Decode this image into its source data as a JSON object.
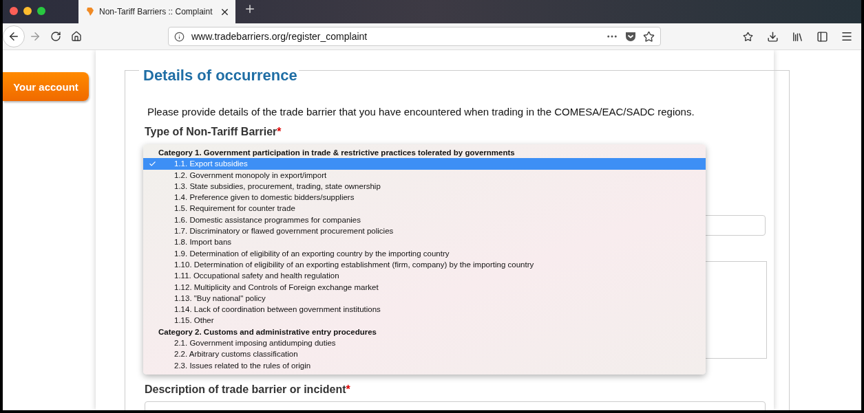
{
  "browser": {
    "tabs": [
      {
        "title": "Non-Tariff Barriers :: Complaint",
        "selected": true
      }
    ],
    "url": "www.tradebarriers.org/register_complaint"
  },
  "sidebar": {
    "button": "Your account"
  },
  "form": {
    "legend": "Details of occurrence",
    "intro": "Please provide details of the trade barrier that you have encountered when trading in the COMESA/EAC/SADC regions.",
    "type_field": {
      "label": "Type of Non-Tariff Barrier",
      "required_mark": "*"
    },
    "dropdown": {
      "groups": [
        {
          "label": "Category 1. Government participation in trade & restrictive practices tolerated by governments",
          "options": [
            {
              "label": "1.1. Export subsidies",
              "selected": true
            },
            {
              "label": "1.2. Government monopoly in export/import",
              "selected": false
            },
            {
              "label": "1.3. State subsidies, procurement, trading, state ownership",
              "selected": false
            },
            {
              "label": "1.4. Preference given to domestic bidders/suppliers",
              "selected": false
            },
            {
              "label": "1.5. Requirement for counter trade",
              "selected": false
            },
            {
              "label": "1.6. Domestic assistance programmes for companies",
              "selected": false
            },
            {
              "label": "1.7. Discriminatory or flawed government procurement policies",
              "selected": false
            },
            {
              "label": "1.8. Import bans",
              "selected": false
            },
            {
              "label": "1.9. Determination of eligibility of an exporting country by the importing country",
              "selected": false
            },
            {
              "label": "1.10. Determination of eligibility of an exporting establishment (firm, company) by the importing country",
              "selected": false
            },
            {
              "label": "1.11. Occupational safety and health regulation",
              "selected": false
            },
            {
              "label": "1.12. Multiplicity and Controls of Foreign exchange market",
              "selected": false
            },
            {
              "label": "1.13. \"Buy national\" policy",
              "selected": false
            },
            {
              "label": "1.14. Lack of coordination between government institutions",
              "selected": false
            },
            {
              "label": "1.15. Other",
              "selected": false
            }
          ]
        },
        {
          "label": "Category 2. Customs and administrative entry procedures",
          "options": [
            {
              "label": "2.1. Government imposing antidumping duties",
              "selected": false
            },
            {
              "label": "2.2. Arbitrary customs classification",
              "selected": false
            },
            {
              "label": "2.3. Issues related to the rules of origin",
              "selected": false
            }
          ]
        }
      ]
    },
    "description_field": {
      "label": "Description of trade barrier or incident",
      "required_mark": "*"
    }
  }
}
